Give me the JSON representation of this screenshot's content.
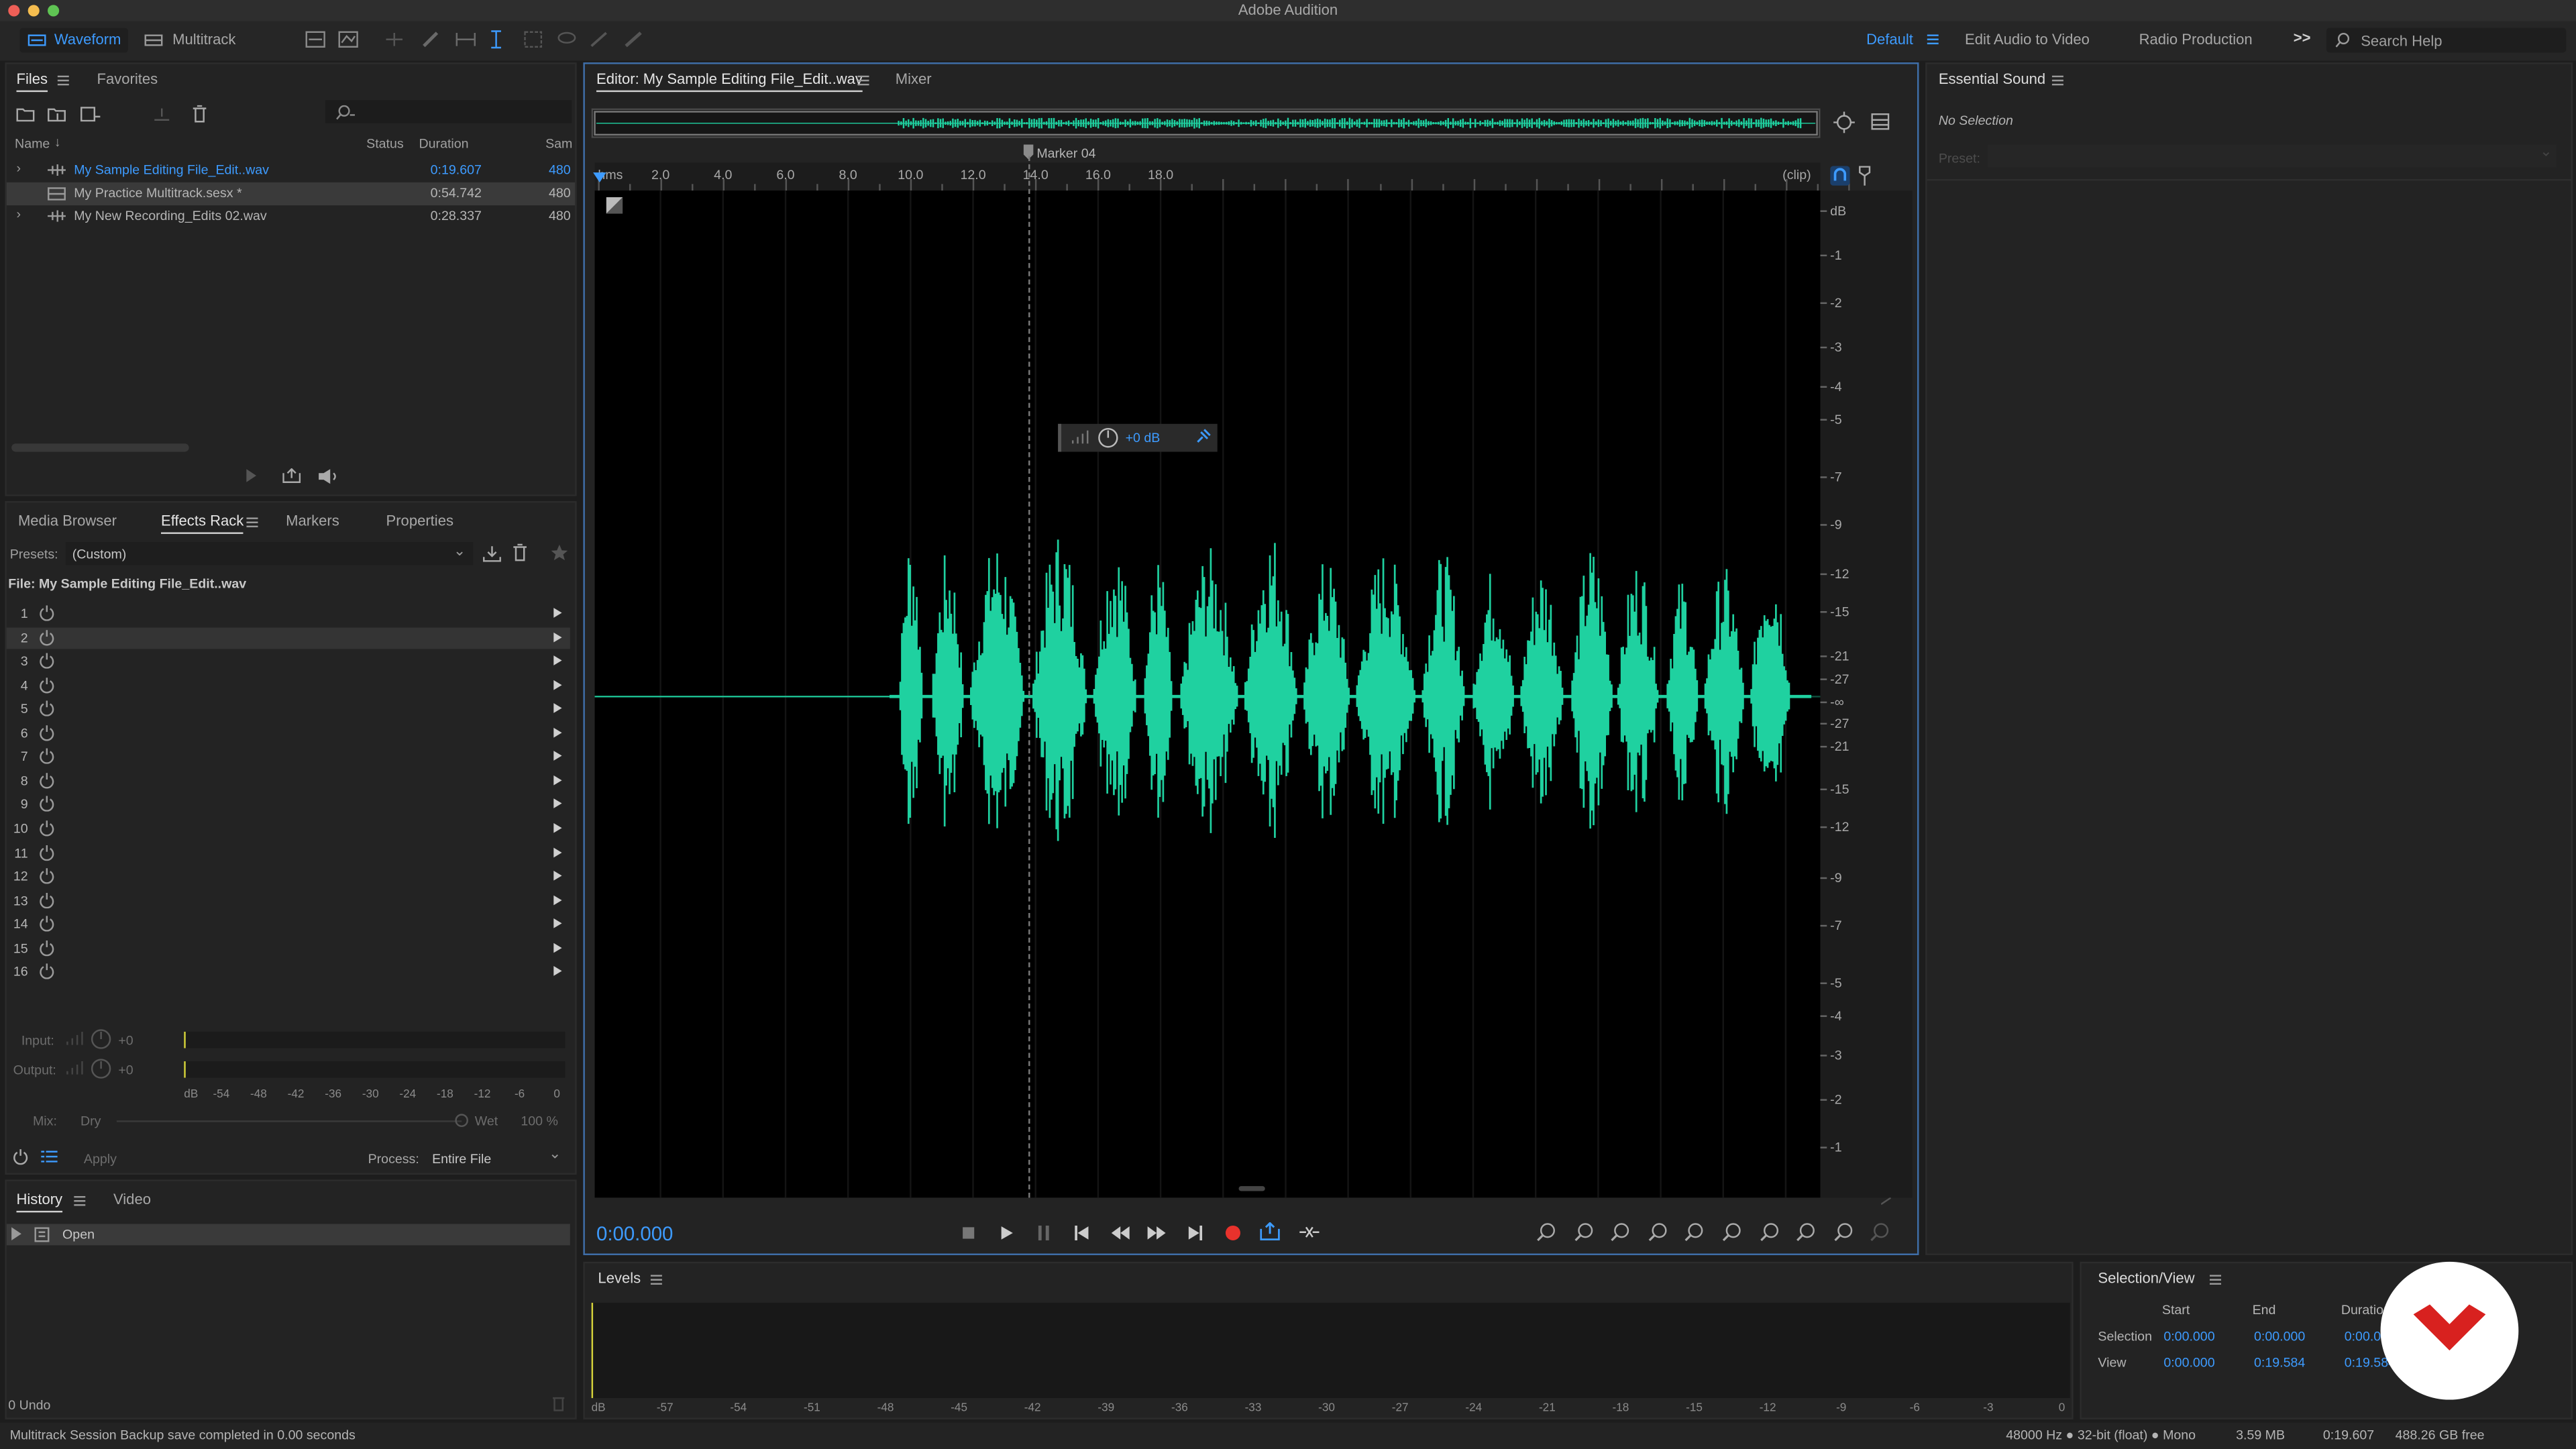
{
  "window": {
    "title": "Adobe Audition"
  },
  "toolbar": {
    "waveform_label": "Waveform",
    "multitrack_label": "Multitrack",
    "workspaces": [
      "Default",
      "Edit Audio to Video",
      "Radio Production"
    ],
    "more": ">>",
    "search_placeholder": "Search Help"
  },
  "files_panel": {
    "tabs": [
      "Files",
      "Favorites"
    ],
    "columns": [
      "Name",
      "Status",
      "Duration",
      "Sam"
    ],
    "files": [
      {
        "name": "My Sample Editing File_Edit..wav",
        "duration": "0:19.607",
        "sample": "480"
      },
      {
        "name": "My Practice Multitrack.sesx *",
        "duration": "0:54.742",
        "sample": "480"
      },
      {
        "name": "My New Recording_Edits 02.wav",
        "duration": "0:28.337",
        "sample": "480"
      }
    ]
  },
  "effects_panel": {
    "tabs": [
      "Media Browser",
      "Effects Rack",
      "Markers",
      "Properties"
    ],
    "presets_label": "Presets:",
    "presets_value": "(Custom)",
    "file_label": "File: My Sample Editing File_Edit..wav",
    "slots": [
      "1",
      "2",
      "3",
      "4",
      "5",
      "6",
      "7",
      "8",
      "9",
      "10",
      "11",
      "12",
      "13",
      "14",
      "15",
      "16"
    ],
    "input_label": "Input:",
    "input_value": "+0",
    "output_label": "Output:",
    "output_value": "+0",
    "meter_ticks": [
      "dB",
      "-54",
      "-48",
      "-42",
      "-36",
      "-30",
      "-24",
      "-18",
      "-12",
      "-6",
      "0"
    ],
    "mix_label": "Mix:",
    "dry_label": "Dry",
    "wet_label": "Wet",
    "wet_value": "100 %",
    "apply_label": "Apply",
    "process_label": "Process:",
    "process_value": "Entire File"
  },
  "history_panel": {
    "tabs": [
      "History",
      "Video"
    ],
    "items": [
      "Open"
    ],
    "undo_label": "0 Undo"
  },
  "editor": {
    "tabs": [
      "Editor: My Sample Editing File_Edit..wav",
      "Mixer"
    ],
    "ruler_labels": [
      "hms",
      "2.0",
      "4.0",
      "6.0",
      "8.0",
      "10.0",
      "12.0",
      "14.0",
      "16.0",
      "18.0",
      "(clip)"
    ],
    "marker_label": "Marker 04",
    "db_labels": [
      "dB",
      "-1",
      "-2",
      "-3",
      "-4",
      "-5",
      "-7",
      "-9",
      "-12",
      "-15",
      "-21",
      "-27",
      "-∞",
      "-27",
      "-21",
      "-15",
      "-12",
      "-9",
      "-7",
      "-5",
      "-4",
      "-3",
      "-2",
      "-1"
    ],
    "hud_value": "+0 dB",
    "time_display": "0:00.000",
    "waveform_color": "#1fd1a0"
  },
  "essential_sound": {
    "title": "Essential Sound",
    "no_selection": "No Selection",
    "preset_label": "Preset:"
  },
  "levels": {
    "title": "Levels",
    "ticks": [
      "dB",
      "-57",
      "-54",
      "-51",
      "-48",
      "-45",
      "-42",
      "-39",
      "-36",
      "-33",
      "-30",
      "-27",
      "-24",
      "-21",
      "-18",
      "-15",
      "-12",
      "-9",
      "-6",
      "-3",
      "0"
    ]
  },
  "selection_view": {
    "title": "Selection/View",
    "headers": [
      "Start",
      "End",
      "Duration"
    ],
    "rows": [
      {
        "label": "Selection",
        "start": "0:00.000",
        "end": "0:00.000",
        "duration": "0:00.000"
      },
      {
        "label": "View",
        "start": "0:00.000",
        "end": "0:19.584",
        "duration": "0:19.584"
      }
    ]
  },
  "status_bar": {
    "message": "Multitrack Session Backup save completed in 0.00 seconds",
    "format": "48000 Hz ● 32-bit (float) ● Mono",
    "size": "3.59 MB",
    "duration": "0:19.607",
    "free": "488.26 GB free"
  },
  "brand_color": "#d8211f"
}
